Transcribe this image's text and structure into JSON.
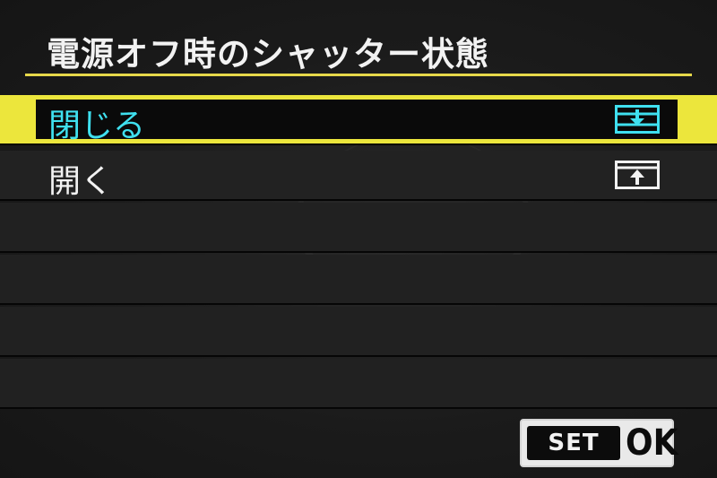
{
  "title": "電源オフ時のシャッター状態",
  "options": [
    {
      "label": "閉じる",
      "icon": "shutter-closed-icon",
      "selected": true
    },
    {
      "label": "開く",
      "icon": "shutter-open-icon",
      "selected": false
    }
  ],
  "footer": {
    "set_label": "SET",
    "ok_label": "OK"
  },
  "colors": {
    "accent": "#ece63c",
    "selected_text": "#3fe0ef",
    "text": "#f2f2f2",
    "background": "#1b1b1b"
  }
}
